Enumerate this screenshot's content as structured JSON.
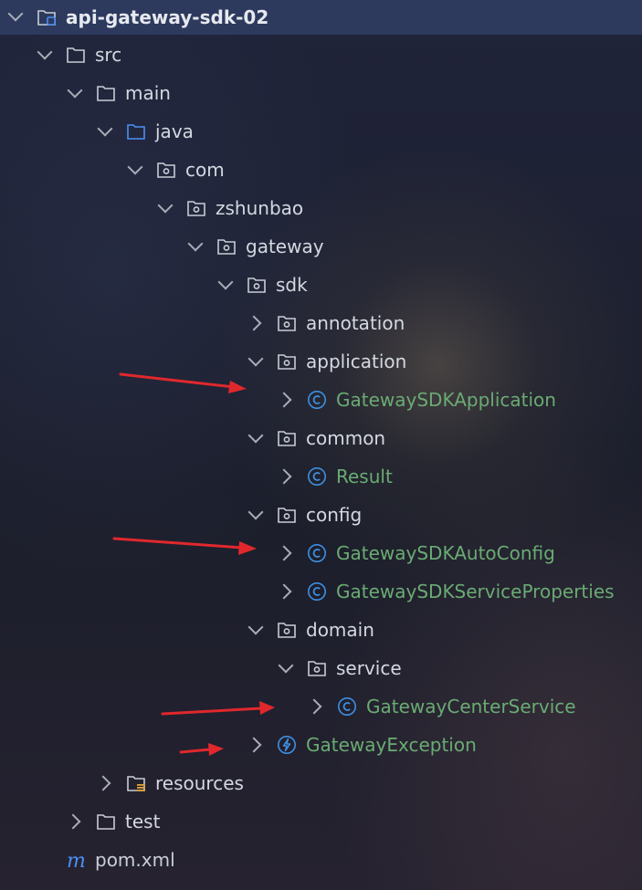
{
  "project_tree": {
    "root": {
      "label": "api-gateway-sdk-02"
    },
    "src": {
      "label": "src"
    },
    "main": {
      "label": "main"
    },
    "java": {
      "label": "java"
    },
    "com": {
      "label": "com"
    },
    "zshunbao": {
      "label": "zshunbao"
    },
    "gateway": {
      "label": "gateway"
    },
    "sdk": {
      "label": "sdk"
    },
    "annotation": {
      "label": "annotation"
    },
    "application": {
      "label": "application"
    },
    "gateway_sdk_application": {
      "label": "GatewaySDKApplication"
    },
    "common": {
      "label": "common"
    },
    "result": {
      "label": "Result"
    },
    "config": {
      "label": "config"
    },
    "gateway_sdk_auto_config": {
      "label": "GatewaySDKAutoConfig"
    },
    "gateway_sdk_service_properties": {
      "label": "GatewaySDKServiceProperties"
    },
    "domain": {
      "label": "domain"
    },
    "service": {
      "label": "service"
    },
    "gateway_center_service": {
      "label": "GatewayCenterService"
    },
    "gateway_exception": {
      "label": "GatewayException"
    },
    "resources": {
      "label": "resources"
    },
    "test": {
      "label": "test"
    },
    "pom": {
      "label": "pom.xml"
    }
  },
  "icons": {
    "module": "module-folder-icon",
    "folder": "folder-icon",
    "source_root": "source-root-folder-icon",
    "package": "package-icon",
    "resources_root": "resources-root-folder-icon",
    "class": "class-icon",
    "exception": "exception-class-icon",
    "maven": "maven-icon"
  },
  "colors": {
    "selection": "#2d3a5e",
    "class_text": "#6aab73",
    "class_icon": "#3d8fe0",
    "source_root": "#4b8ff5",
    "annotation_arrow": "#e0282c"
  }
}
